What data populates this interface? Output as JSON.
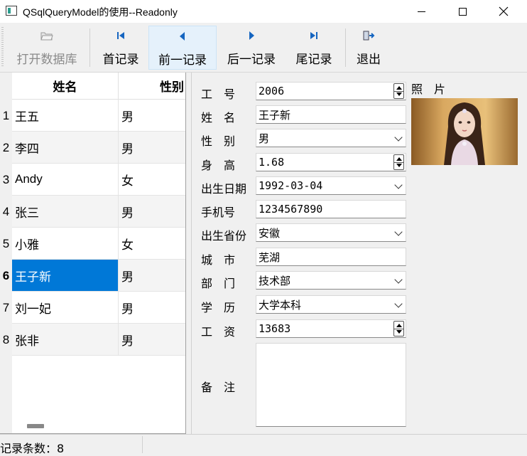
{
  "window": {
    "title": "QSqlQueryModel的使用--Readonly"
  },
  "toolbar": {
    "open_db": "打开数据库",
    "first": "首记录",
    "prev": "前一记录",
    "next": "后一记录",
    "last": "尾记录",
    "exit": "退出",
    "hovered": "prev"
  },
  "table": {
    "columns": [
      "姓名",
      "性别"
    ],
    "rows": [
      {
        "num": "1",
        "name": "王五",
        "sex": "男"
      },
      {
        "num": "2",
        "name": "李四",
        "sex": "男"
      },
      {
        "num": "3",
        "name": "Andy",
        "sex": "女"
      },
      {
        "num": "4",
        "name": "张三",
        "sex": "男"
      },
      {
        "num": "5",
        "name": "小雅",
        "sex": "女"
      },
      {
        "num": "6",
        "name": "王子新",
        "sex": "男"
      },
      {
        "num": "7",
        "name": "刘一妃",
        "sex": "男"
      },
      {
        "num": "8",
        "name": "张非",
        "sex": "男"
      }
    ],
    "selected_row": "6"
  },
  "form": {
    "labels": {
      "empno": "工　号",
      "name": "姓　名",
      "gender": "性　别",
      "height": "身　高",
      "birthday": "出生日期",
      "mobile": "手机号",
      "province": "出生省份",
      "city": "城　市",
      "department": "部　门",
      "education": "学　历",
      "salary": "工　资",
      "memo": "备　注",
      "photo": "照　片"
    },
    "values": {
      "empno": "2006",
      "name": "王子新",
      "gender": "男",
      "height": "1.68",
      "birthday": "1992-03-04",
      "mobile": "1234567890",
      "province": "安徽",
      "city": "芜湖",
      "department": "技术部",
      "education": "大学本科",
      "salary": "13683",
      "memo": ""
    }
  },
  "statusbar": {
    "text": "记录条数：8"
  },
  "colors": {
    "selection": "#0078d7",
    "hover": "#e5f1fb",
    "nav_icon": "#1565c0"
  }
}
